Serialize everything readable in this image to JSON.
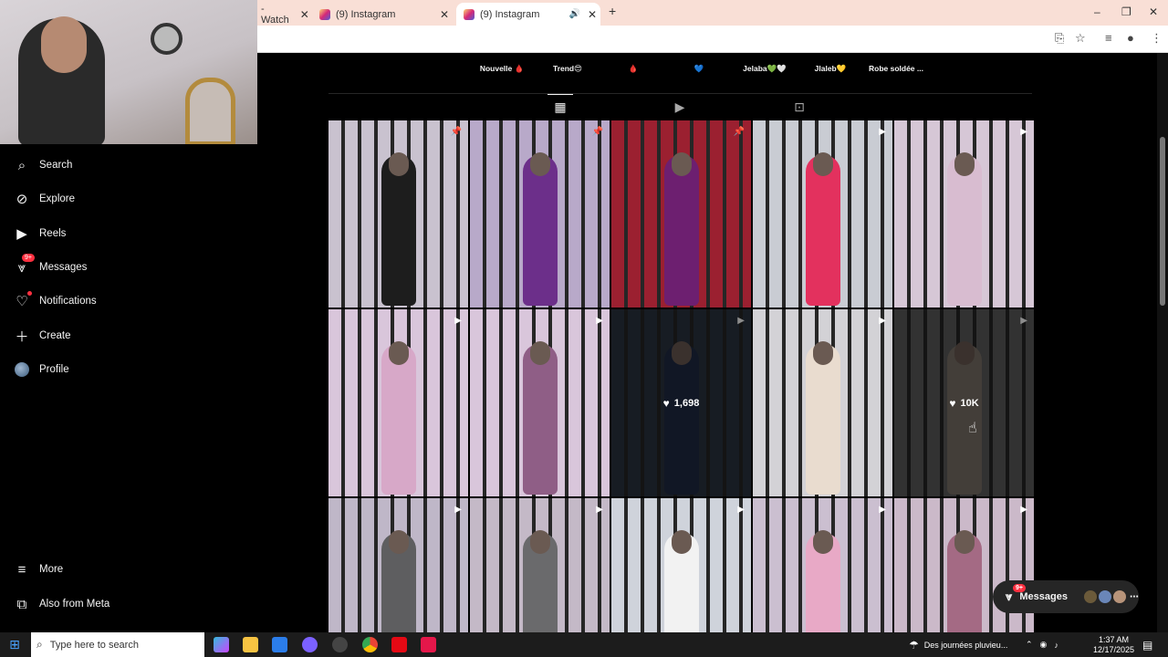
{
  "browser": {
    "tabs": [
      {
        "label": "- Watch",
        "active": false
      },
      {
        "label": "(9) Instagram",
        "active": false
      },
      {
        "label": "(9) Instagram",
        "active": true
      }
    ],
    "new_tab": "+",
    "window_controls": [
      "–",
      "❐",
      "✕"
    ]
  },
  "sidebar": {
    "items": [
      {
        "label": "Search",
        "icon": "search-icon"
      },
      {
        "label": "Explore",
        "icon": "compass-icon"
      },
      {
        "label": "Reels",
        "icon": "reels-icon"
      },
      {
        "label": "Messages",
        "icon": "messenger-icon",
        "badge": "9+"
      },
      {
        "label": "Notifications",
        "icon": "heart-icon",
        "dot": true
      },
      {
        "label": "Create",
        "icon": "plus-icon"
      },
      {
        "label": "Profile",
        "icon": "avatar"
      }
    ],
    "bottom": [
      {
        "label": "More",
        "icon": "menu-icon"
      },
      {
        "label": "Also from Meta",
        "icon": "meta-icon"
      }
    ]
  },
  "highlights": [
    "Nouvelle 🩸",
    "Trend😍",
    "🩸",
    "💙",
    "Jelaba💚🤍",
    "Jlaleb💛",
    "Robe soldée ..."
  ],
  "profile_tabs": [
    "posts-grid-icon",
    "reels-tab-icon",
    "tagged-icon"
  ],
  "posts": [
    {
      "row": 0,
      "col": 0,
      "type": "pinned",
      "palette": [
        "#c9c2cf",
        "#1d1d1d"
      ]
    },
    {
      "row": 0,
      "col": 1,
      "type": "pinned",
      "palette": [
        "#b8a9c9",
        "#6c2f8a"
      ]
    },
    {
      "row": 0,
      "col": 2,
      "type": "pinned",
      "palette": [
        "#9b2030",
        "#6d1f70"
      ]
    },
    {
      "row": 0,
      "col": 3,
      "type": "reel",
      "palette": [
        "#c9ccd3",
        "#e3315e"
      ]
    },
    {
      "row": 0,
      "col": 4,
      "type": "reel",
      "palette": [
        "#d6c7d6",
        "#d8bcd0"
      ]
    },
    {
      "row": 1,
      "col": 0,
      "type": "reel",
      "palette": [
        "#d9c6db",
        "#d7a8c8"
      ]
    },
    {
      "row": 1,
      "col": 1,
      "type": "reel",
      "palette": [
        "#d9c6db",
        "#8f5e86"
      ]
    },
    {
      "row": 1,
      "col": 2,
      "type": "reel",
      "palette": [
        "#2b3440",
        "#1f2a44"
      ],
      "likes": "1,698"
    },
    {
      "row": 1,
      "col": 3,
      "type": "reel",
      "palette": [
        "#d3d2d6",
        "#e9dccf"
      ]
    },
    {
      "row": 1,
      "col": 4,
      "type": "reel",
      "palette": [
        "#5b5b5b",
        "#7a7268"
      ],
      "likes": "10K"
    },
    {
      "row": 2,
      "col": 0,
      "type": "reel",
      "palette": [
        "#bfb7c8",
        "#5e5e60"
      ]
    },
    {
      "row": 2,
      "col": 1,
      "type": "reel",
      "palette": [
        "#c4b9c7",
        "#6a6a6c"
      ]
    },
    {
      "row": 2,
      "col": 2,
      "type": "reel",
      "palette": [
        "#cfd3db",
        "#f2f2f2"
      ]
    },
    {
      "row": 2,
      "col": 3,
      "type": "reel",
      "palette": [
        "#cbbfd0",
        "#e8a9c6"
      ]
    },
    {
      "row": 2,
      "col": 4,
      "type": "reel",
      "palette": [
        "#cbb9c9",
        "#a46a84"
      ]
    }
  ],
  "floating_messages": {
    "label": "Messages",
    "badge": "9+"
  },
  "taskbar": {
    "search_placeholder": "Type here to search",
    "weather": "Des journées pluvieu...",
    "time": "1:37 AM",
    "date": "12/17/2025"
  }
}
